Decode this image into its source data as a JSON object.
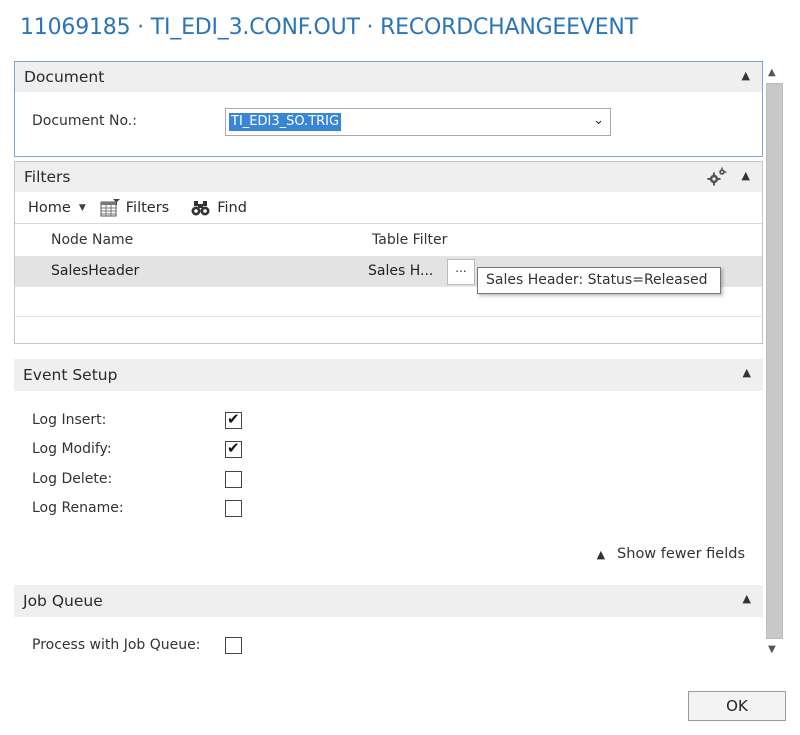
{
  "window": {
    "title": "11069185 · TI_EDI_3.CONF.OUT · RECORDCHANGEEVENT"
  },
  "document": {
    "header": "Document",
    "doc_no_label": "Document No.:",
    "doc_no_value": "TI_EDI3_SO.TRIG"
  },
  "filters": {
    "header": "Filters",
    "toolbar": {
      "home": "Home",
      "filters": "Filters",
      "find": "Find"
    },
    "columns": [
      "Node Name",
      "Table Filter"
    ],
    "rows": [
      {
        "node_name": "SalesHeader",
        "table_filter": "Sales H...",
        "ellipsis": "..."
      }
    ],
    "tooltip": "Sales Header: Status=Released"
  },
  "event_setup": {
    "header": "Event Setup",
    "fields": [
      {
        "label": "Log Insert:",
        "checked": true
      },
      {
        "label": "Log Modify:",
        "checked": true
      },
      {
        "label": "Log Delete:",
        "checked": false
      },
      {
        "label": "Log Rename:",
        "checked": false
      }
    ],
    "show_fewer": "Show fewer fields"
  },
  "job_queue": {
    "header": "Job Queue",
    "process_label": "Process with Job Queue:",
    "process_checked": false
  },
  "buttons": {
    "ok": "OK"
  },
  "icons": {
    "collapse": "chevron-up-icon",
    "dropdown": "chevron-down-icon",
    "gear": "gear-icon",
    "filters": "filter-grid-icon",
    "find": "binoculars-icon"
  },
  "colors": {
    "title": "#2a74b8",
    "selection": "#3a86d6",
    "focus_border": "#7aa7d6"
  }
}
